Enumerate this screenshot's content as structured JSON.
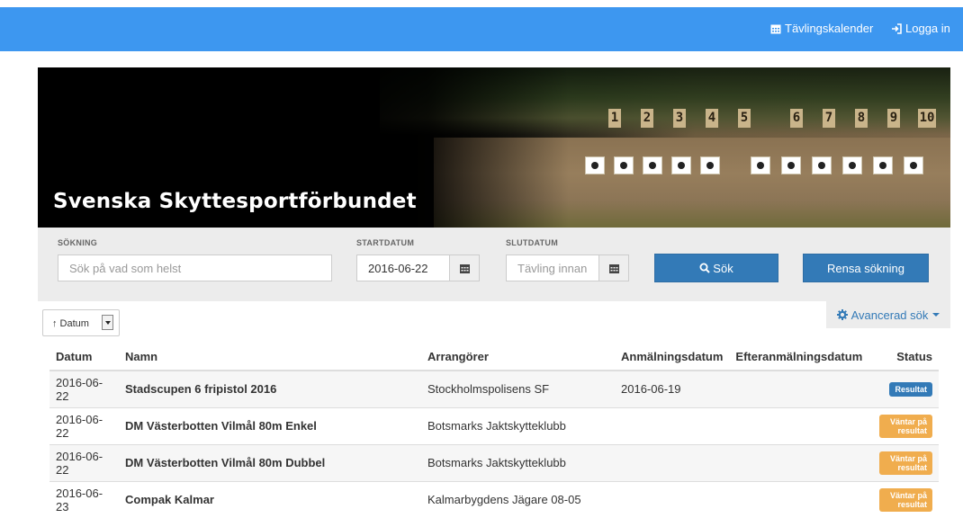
{
  "nav": {
    "calendar_label": "Tävlingskalender",
    "login_label": "Logga in"
  },
  "hero": {
    "title": "Svenska Skyttesportförbundet",
    "lane_numbers": [
      "1",
      "2",
      "3",
      "4",
      "5",
      "6",
      "7",
      "8",
      "9",
      "10"
    ]
  },
  "search": {
    "query_label": "SÖKNING",
    "query_placeholder": "Sök på vad som helst",
    "start_label": "STARTDATUM",
    "start_value": "2016-06-22",
    "end_label": "SLUTDATUM",
    "end_placeholder": "Tävling innan",
    "search_button": "Sök",
    "reset_button": "Rensa sökning"
  },
  "sort": {
    "selected": "↑ Datum"
  },
  "advanced_search": "Avancerad sök",
  "table": {
    "headers": {
      "date": "Datum",
      "name": "Namn",
      "organizers": "Arrangörer",
      "registration": "Anmälningsdatum",
      "late_registration": "Efteranmälningsdatum",
      "status": "Status"
    },
    "rows": [
      {
        "date": "2016-06-22",
        "name": "Stadscupen 6 fripistol 2016",
        "organizer": "Stockholmspolisens SF",
        "registration": "2016-06-19",
        "late_registration": "",
        "status": "Resultat"
      },
      {
        "date": "2016-06-22",
        "name": "DM Västerbotten Vilmål 80m Enkel",
        "organizer": "Botsmarks Jaktskytteklubb",
        "registration": "",
        "late_registration": "",
        "status": "Väntar på resultat"
      },
      {
        "date": "2016-06-22",
        "name": "DM Västerbotten Vilmål 80m Dubbel",
        "organizer": "Botsmarks Jaktskytteklubb",
        "registration": "",
        "late_registration": "",
        "status": "Väntar på resultat"
      },
      {
        "date": "2016-06-23",
        "name": "Compak Kalmar",
        "organizer": "Kalmarbygdens Jägare 08-05",
        "registration": "",
        "late_registration": "",
        "status": "Väntar på resultat"
      }
    ]
  },
  "colors": {
    "topbar": "#3d97f0",
    "primary": "#337ab7",
    "warning": "#f0ad4e"
  }
}
